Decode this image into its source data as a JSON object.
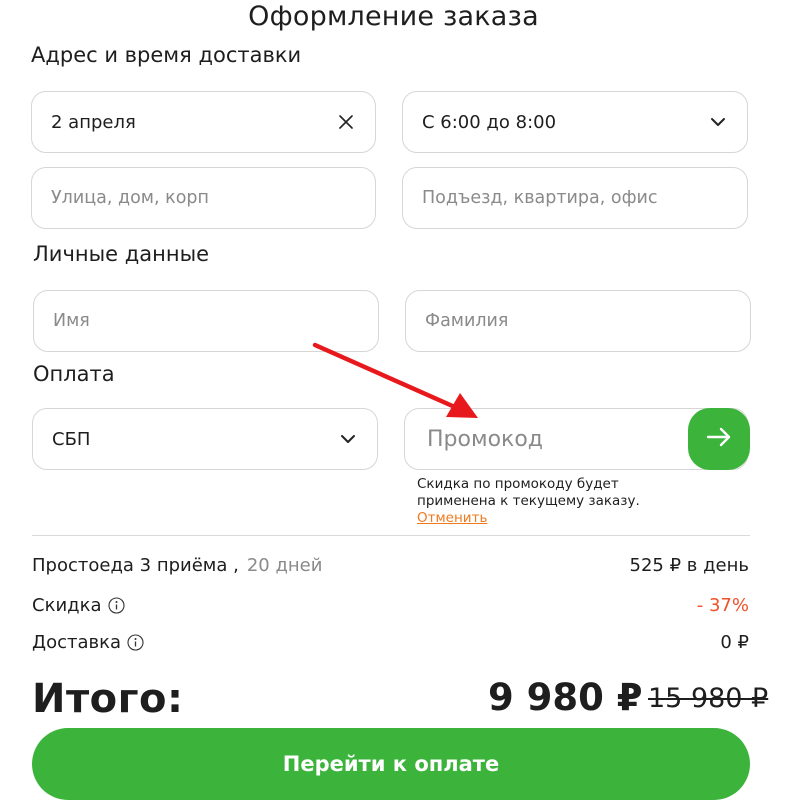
{
  "page": {
    "title": "Оформление заказа"
  },
  "delivery": {
    "section_title": "Адрес и время доставки",
    "date_value": "2 апреля",
    "time_value": "С 6:00 до 8:00",
    "street_placeholder": "Улица, дом, корп",
    "entrance_placeholder": "Подъезд, квартира, офис"
  },
  "personal": {
    "section_title": "Личные данные",
    "first_name_placeholder": "Имя",
    "last_name_placeholder": "Фамилия"
  },
  "payment": {
    "section_title": "Оплата",
    "method_value": "СБП",
    "promo_placeholder": "Промокод",
    "promo_note": "Скидка по промокоду будет применена к текущему заказу.",
    "promo_cancel": "Отменить"
  },
  "summary": {
    "plan_label": "Простоеда 3 приёма ,",
    "plan_duration": "20 дней",
    "plan_price": "525 ₽ в день",
    "discount_label": "Скидка",
    "discount_value": "- 37%",
    "delivery_label": "Доставка",
    "delivery_value": "0 ₽",
    "total_label": "Итого:",
    "total_price": "9 980 ₽",
    "old_price": "15 980 ₽"
  },
  "actions": {
    "pay_label": "Перейти к оплате"
  },
  "colors": {
    "accent_green": "#3cb43c",
    "discount_red": "#f0502a",
    "cancel_orange": "#f07a1f",
    "annotation_red": "#e8191c"
  },
  "icons": {
    "clear": "close-icon",
    "dropdown": "chevron-down-icon",
    "promo_submit": "arrow-right-icon",
    "info": "info-icon"
  }
}
